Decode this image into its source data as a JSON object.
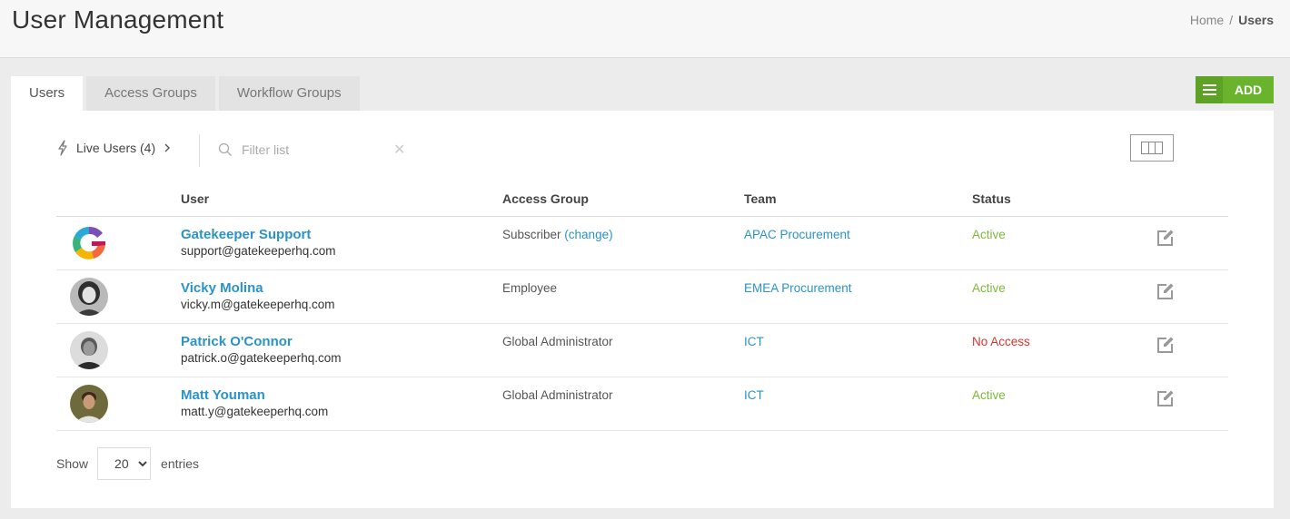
{
  "header": {
    "title": "User Management",
    "breadcrumb": {
      "home": "Home",
      "separator": "/",
      "current": "Users"
    }
  },
  "tabs": [
    {
      "label": "Users",
      "active": true
    },
    {
      "label": "Access Groups",
      "active": false
    },
    {
      "label": "Workflow Groups",
      "active": false
    }
  ],
  "add_button": {
    "label": "ADD",
    "icon": "hamburger-icon",
    "color": "#6ab42d"
  },
  "toolbar": {
    "live_users_label": "Live Users (4)",
    "live_icon": "lightning-icon",
    "filter_placeholder": "Filter list",
    "filter_value": "",
    "columns_icon": "columns-icon"
  },
  "table": {
    "headers": {
      "avatar": "",
      "user": "User",
      "access_group": "Access Group",
      "team": "Team",
      "status": "Status"
    },
    "rows": [
      {
        "avatar": "gatekeeper-logo",
        "name": "Gatekeeper Support",
        "email": "support@gatekeeperhq.com",
        "access_group": "Subscriber",
        "change_link": "(change)",
        "team": "APAC Procurement",
        "status": "Active"
      },
      {
        "avatar": "user-photo",
        "name": "Vicky Molina",
        "email": "vicky.m@gatekeeperhq.com",
        "access_group": "Employee",
        "team": "EMEA Procurement",
        "status": "Active"
      },
      {
        "avatar": "user-photo",
        "name": "Patrick O'Connor",
        "email": "patrick.o@gatekeeperhq.com",
        "access_group": "Global Administrator",
        "team": "ICT",
        "status": "No Access"
      },
      {
        "avatar": "user-photo",
        "name": "Matt Youman",
        "email": "matt.y@gatekeeperhq.com",
        "access_group": "Global Administrator",
        "team": "ICT",
        "status": "Active"
      }
    ]
  },
  "pagination": {
    "show_label": "Show",
    "page_size": "20",
    "entries_label": "entries"
  },
  "colors": {
    "link": "#2a93c8",
    "active": "#7cba3a",
    "no_access": "#d9342b",
    "accent": "#6ab42d"
  }
}
